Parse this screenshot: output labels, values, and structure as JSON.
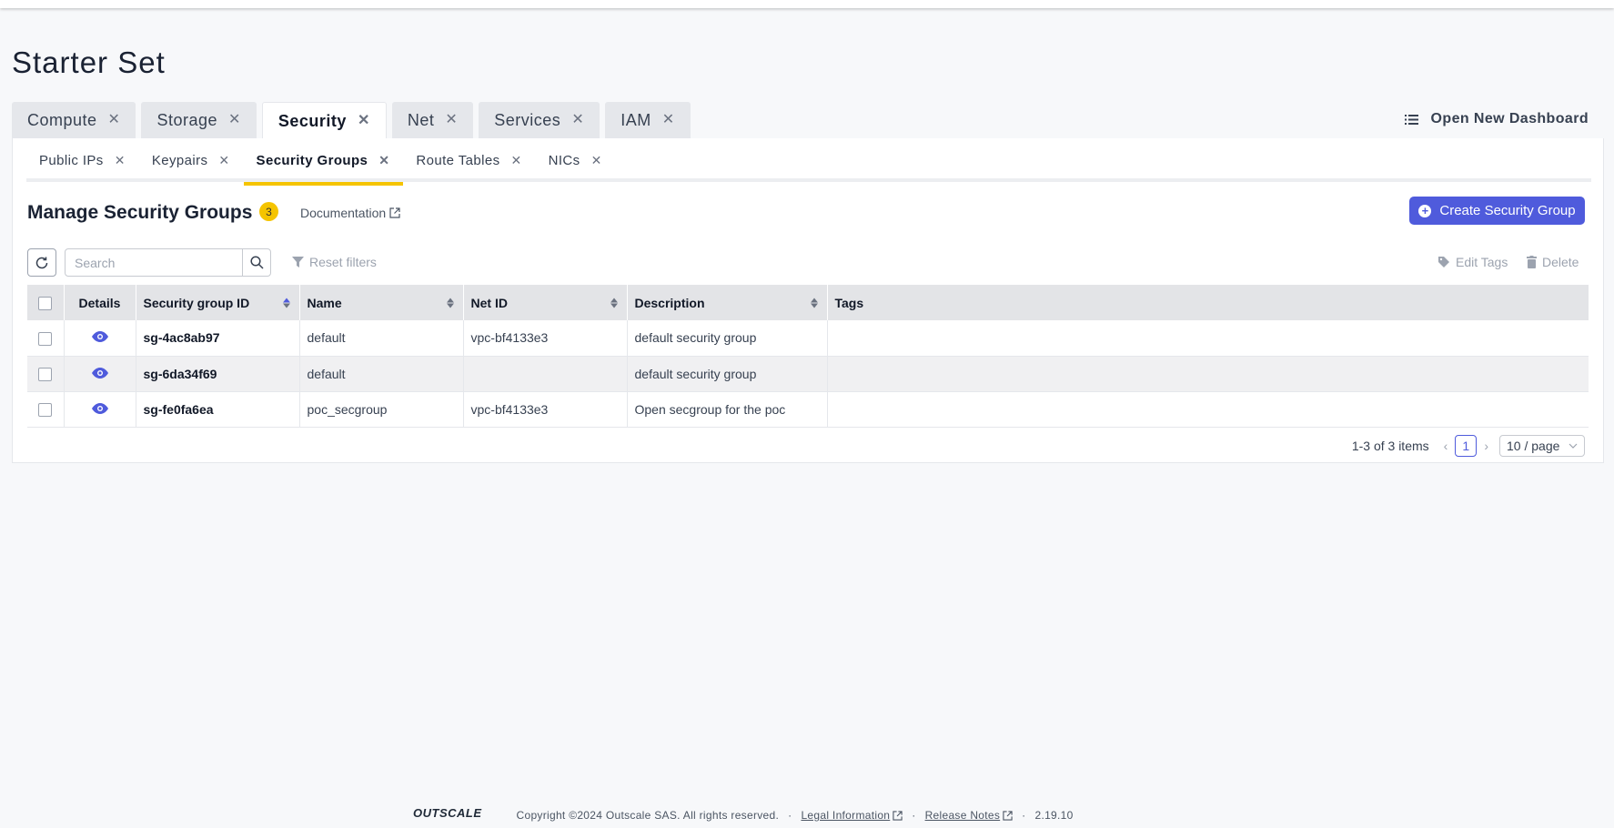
{
  "page": {
    "title": "Starter Set"
  },
  "main_tabs": [
    {
      "label": "Compute",
      "active": false
    },
    {
      "label": "Storage",
      "active": false
    },
    {
      "label": "Security",
      "active": true
    },
    {
      "label": "Net",
      "active": false
    },
    {
      "label": "Services",
      "active": false
    },
    {
      "label": "IAM",
      "active": false
    }
  ],
  "toolbar": {
    "open_dashboard_label": "Open New Dashboard"
  },
  "sub_tabs": [
    {
      "label": "Public IPs",
      "active": false
    },
    {
      "label": "Keypairs",
      "active": false
    },
    {
      "label": "Security Groups",
      "active": true
    },
    {
      "label": "Route Tables",
      "active": false
    },
    {
      "label": "NICs",
      "active": false
    }
  ],
  "section": {
    "title": "Manage Security Groups",
    "count": "3",
    "documentation_label": "Documentation",
    "create_label": "Create Security Group"
  },
  "filters": {
    "search_placeholder": "Search",
    "reset_label": "Reset filters",
    "edit_tags_label": "Edit Tags",
    "delete_label": "Delete"
  },
  "table": {
    "columns": [
      "Details",
      "Security group ID",
      "Name",
      "Net ID",
      "Description",
      "Tags"
    ],
    "rows": [
      {
        "id": "sg-4ac8ab97",
        "name": "default",
        "net_id": "vpc-bf4133e3",
        "description": "default security group",
        "tags": ""
      },
      {
        "id": "sg-6da34f69",
        "name": "default",
        "net_id": "",
        "description": "default security group",
        "tags": ""
      },
      {
        "id": "sg-fe0fa6ea",
        "name": "poc_secgroup",
        "net_id": "vpc-bf4133e3",
        "description": "Open secgroup for the poc",
        "tags": ""
      }
    ]
  },
  "pagination": {
    "summary": "1-3 of 3 items",
    "current_page": "1",
    "page_size": "10 / page"
  },
  "footer": {
    "logo_text": "OUTSCALE",
    "copyright": "Copyright ©2024 Outscale SAS. All rights reserved.",
    "legal_label": "Legal Information",
    "release_notes_label": "Release Notes",
    "version": "2.19.10",
    "separator_dot": "·"
  },
  "colors": {
    "accent": "#4f5bdc",
    "active_tab_underline": "#f5c400",
    "badge": "#f5c400"
  }
}
